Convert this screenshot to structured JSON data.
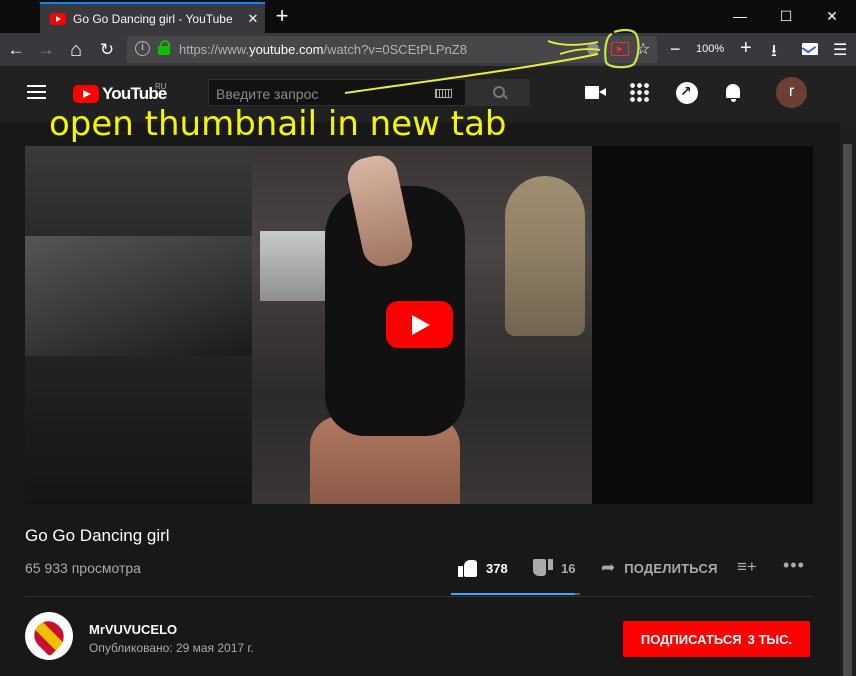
{
  "browser": {
    "tab_title": "Go Go Dancing girl - YouTube",
    "tab_close": "✕",
    "new_tab": "+",
    "win_min": "—",
    "win_max": "☐",
    "win_close": "✕",
    "url_prefix": "https://www.",
    "url_host": "youtube.com",
    "url_path": "/watch?v=0SCEtPLPnZ8",
    "zoom": "100%",
    "back": "←",
    "forward": "→",
    "home": "⌂",
    "reload": "↻",
    "star": "☆",
    "zoom_minus": "−",
    "zoom_plus": "+",
    "download": "⭳",
    "menu": "☰"
  },
  "youtube": {
    "logo_text": "YouTube",
    "region": "RU",
    "search_placeholder": "Введите запрос",
    "avatar_letter": "r"
  },
  "video": {
    "title": "Go Go Dancing girl",
    "views": "65 933 просмотра",
    "likes": "378",
    "dislikes": "16",
    "share_label": "ПОДЕЛИТЬСЯ",
    "like_ratio": 0.96,
    "share_icon": "➦",
    "add_to_list_icon": "≡+",
    "more_icon": "•••"
  },
  "channel": {
    "name": "MrVUVUCELO",
    "published": "Опубликовано: 29 мая 2017 г.",
    "subscribe_label": "ПОДПИСАТЬСЯ",
    "subscribers": "3 ТЫС."
  },
  "annotation": {
    "text": "open thumbnail in new tab",
    "color": "#f5f500"
  },
  "colors": {
    "accent": "#ff0000",
    "like_bar": "#3ea6ff",
    "page_bg": "#181818",
    "header_bg": "#212121"
  }
}
